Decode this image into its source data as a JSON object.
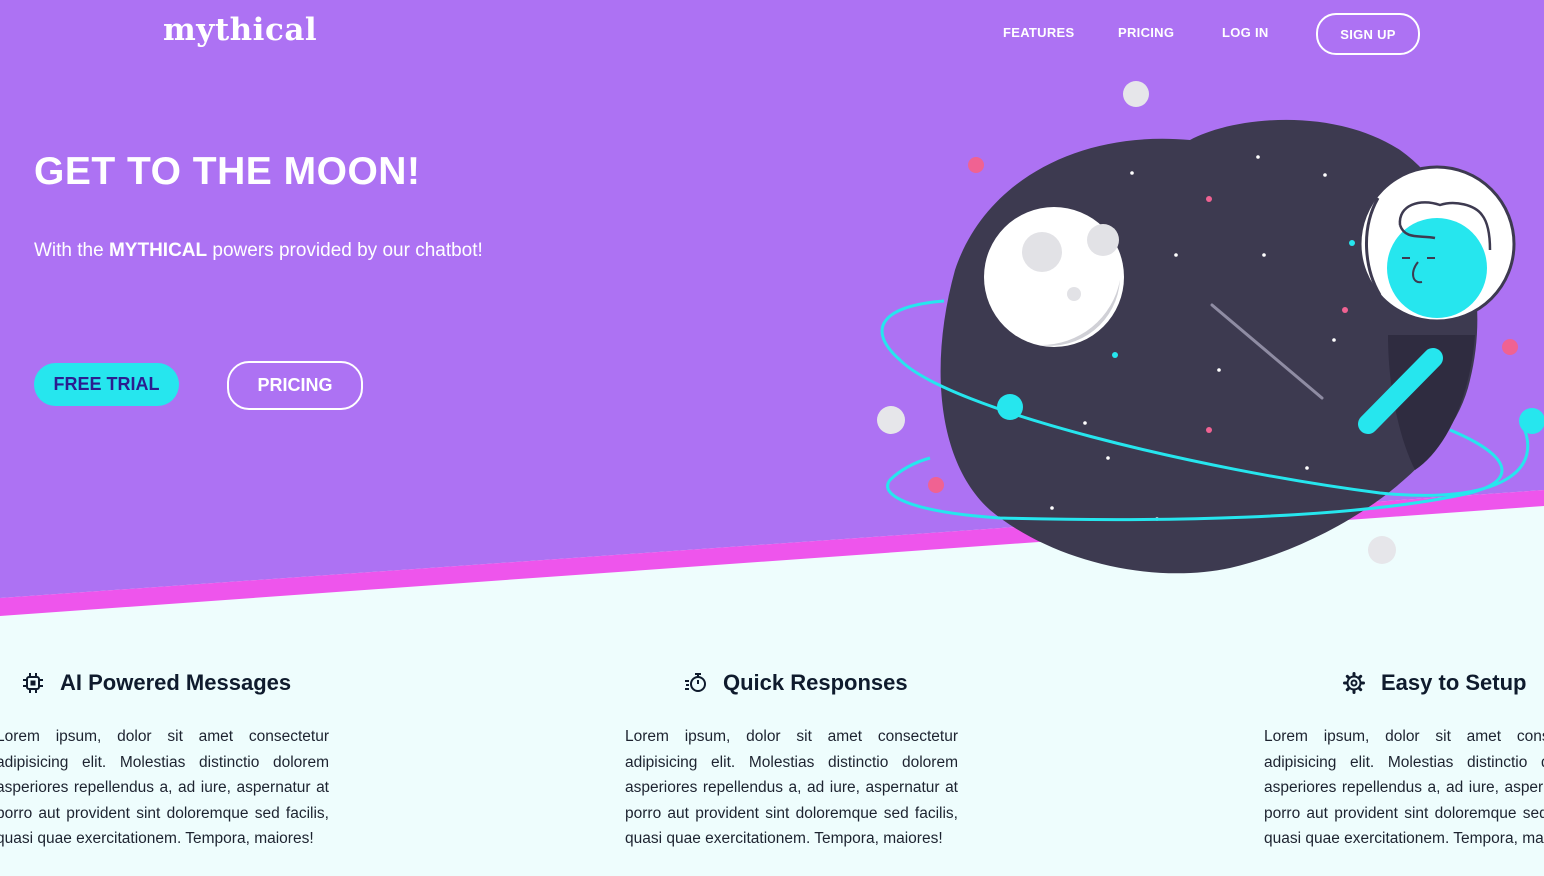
{
  "brand": {
    "logo": "mythical"
  },
  "nav": {
    "features": "FEATURES",
    "pricing": "PRICING",
    "login": "LOG IN",
    "signup": "SIGN UP"
  },
  "hero": {
    "title": "GET TO THE MOON!",
    "subtitle_prefix": "With the ",
    "subtitle_bold": "MYTHICAL",
    "subtitle_suffix": " powers provided by our chatbot!",
    "free_trial": "FREE TRIAL",
    "pricing": "PRICING"
  },
  "features": [
    {
      "icon": "cpu-chip-icon",
      "title": "AI Powered Messages",
      "text": "Lorem ipsum, dolor sit amet consectetur adipisicing elit. Molestias distinctio dolorem asperiores repellendus a, ad iure, aspernatur at porro aut provident sint doloremque sed facilis, quasi quae exercitationem. Tempora, maiores!"
    },
    {
      "icon": "stopwatch-icon",
      "title": "Quick Responses",
      "text": "Lorem ipsum, dolor sit amet consectetur adipisicing elit. Molestias distinctio dolorem asperiores repellendus a, ad iure, aspernatur at porro aut provident sint doloremque sed facilis, quasi quae exercitationem. Tempora, maiores!"
    },
    {
      "icon": "gear-icon",
      "title": "Easy to Setup",
      "text": "Lorem ipsum, dolor sit amet consectetur adipisicing elit. Molestias distinctio dolorem asperiores repellendus a, ad iure, aspernatur at porro aut provident sint doloremque sed facilis, quasi quae exercitationem. Tempora, maiores!"
    }
  ],
  "colors": {
    "hero_purple": "#ad72f3",
    "accent_pink": "#ee55ec",
    "cyan": "#26e6ee",
    "planet": "#3d3a50",
    "section_bg": "#eefdfd"
  }
}
